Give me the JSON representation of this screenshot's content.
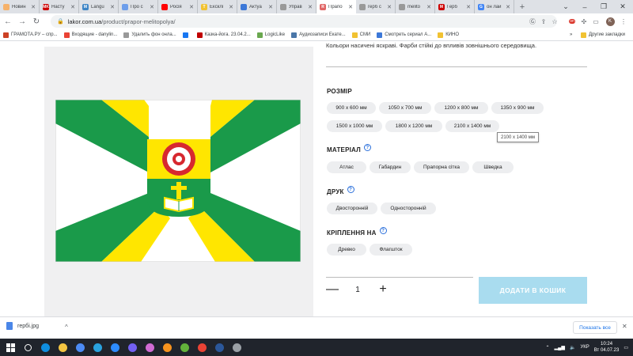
{
  "browser": {
    "tabs": [
      {
        "label": "Новин",
        "color": "#f6b26b"
      },
      {
        "label": "Насту",
        "color": "#cc0000",
        "glyph": "MK"
      },
      {
        "label": "Langu",
        "color": "#3d85c6",
        "glyph": "M"
      },
      {
        "label": "Про с",
        "color": "#6d9eeb"
      },
      {
        "label": "Росія",
        "color": "#ff0000"
      },
      {
        "label": "Ексклі",
        "color": "#f1c232",
        "glyph": "T"
      },
      {
        "label": "Актуа",
        "color": "#3c78d8"
      },
      {
        "label": "Управ",
        "color": "#999999"
      },
      {
        "label": "Прапо",
        "color": "#e06666",
        "glyph": "R",
        "active": true
      },
      {
        "label": "герб с",
        "color": "#999999"
      },
      {
        "label": "melito",
        "color": "#999999"
      },
      {
        "label": "Герб",
        "color": "#cc0000",
        "glyph": "M"
      },
      {
        "label": "он лай",
        "color": "#4285f4",
        "glyph": "G"
      }
    ],
    "address": {
      "domain": "lakor.com.ua",
      "path": "/product/prapor-melitopolya/"
    },
    "profile_initial": "K",
    "bookmarks": [
      {
        "label": "ГРАМОТА.РУ – спр...",
        "color": "#cc4125"
      },
      {
        "label": "Входящие - danylin...",
        "color": "#ea4335"
      },
      {
        "label": "Удалить фон онла...",
        "color": "#999999"
      },
      {
        "label": "",
        "color": "#1877f2"
      },
      {
        "label": "Казка-йога. 23.04.2...",
        "color": "#c00000"
      },
      {
        "label": "LogicLike",
        "color": "#6aa84f"
      },
      {
        "label": "Аудиозаписи Екате...",
        "color": "#4a76a8"
      },
      {
        "label": "СМИ",
        "color": "#f1c232"
      },
      {
        "label": "Смотреть сериал А...",
        "color": "#3c78d8"
      },
      {
        "label": "КИНО",
        "color": "#f1c232"
      }
    ],
    "other_bookmarks": "Другие закладки"
  },
  "product": {
    "description": "Кольори насичені яскраві. Фарби стійкі до впливів зовнішнього середовища.",
    "sections": {
      "size": {
        "title": "РОЗМІР",
        "options": [
          "900 x 600 мм",
          "1050 x 700 мм",
          "1200 x 800 мм",
          "1350 x 900 мм",
          "1500 x 1000 мм",
          "1800 x 1200 мм",
          "2100 x 1400 мм"
        ]
      },
      "material": {
        "title": "МАТЕРІАЛ",
        "options": [
          "Атлас",
          "Габардин",
          "Прапорна сітка",
          "Шведка"
        ]
      },
      "print": {
        "title": "ДРУК",
        "options": [
          "Двосторонній",
          "Односторонній"
        ]
      },
      "mount": {
        "title": "КРІПЛЕННЯ НА",
        "options": [
          "Древко",
          "Флагшток"
        ]
      }
    },
    "tooltip": "2100 x 1400 мм",
    "quantity": "1",
    "add_to_cart": "ДОДАТИ В КОШИК"
  },
  "flag_colors": {
    "green": "#1a9a4a",
    "yellow": "#ffe600",
    "white": "#ffffff",
    "red": "#d7282f"
  },
  "downloads": {
    "file": "гербі.jpg",
    "show_all": "Показать все"
  },
  "taskbar": {
    "lang": "УКР",
    "time": "10:24",
    "date": "Вт 04.07.23",
    "apps": [
      {
        "name": "windows-icon",
        "color": "#ffffff"
      },
      {
        "name": "search-icon",
        "color": "#ffffff"
      },
      {
        "name": "edge-icon",
        "color": "#0f8ee0"
      },
      {
        "name": "folder-icon",
        "color": "#f4c542"
      },
      {
        "name": "store-icon",
        "color": "#4c8bf5"
      },
      {
        "name": "telegram-icon",
        "color": "#2aa3df"
      },
      {
        "name": "zoom-icon",
        "color": "#2d8cff"
      },
      {
        "name": "viber-icon",
        "color": "#7360f2"
      },
      {
        "name": "photos-icon",
        "color": "#d16bd3"
      },
      {
        "name": "ok-icon",
        "color": "#f7931e"
      },
      {
        "name": "torrent-icon",
        "color": "#63b33b"
      },
      {
        "name": "chrome-icon",
        "color": "#ea4335"
      },
      {
        "name": "word-icon",
        "color": "#2b579a"
      },
      {
        "name": "snip-icon",
        "color": "#9aa0a6"
      }
    ]
  }
}
